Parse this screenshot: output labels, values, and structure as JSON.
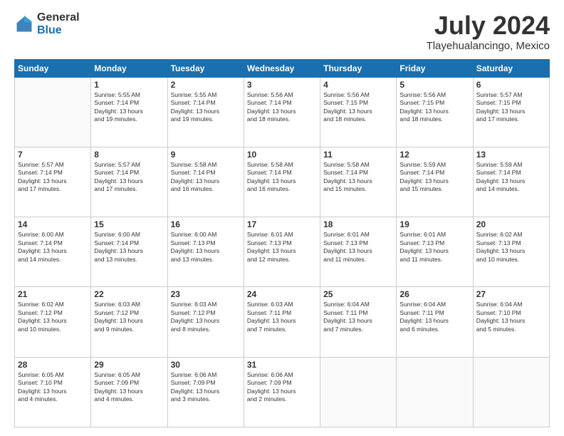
{
  "logo": {
    "general": "General",
    "blue": "Blue"
  },
  "header": {
    "month": "July 2024",
    "location": "Tlayehualancingo, Mexico"
  },
  "weekdays": [
    "Sunday",
    "Monday",
    "Tuesday",
    "Wednesday",
    "Thursday",
    "Friday",
    "Saturday"
  ],
  "weeks": [
    [
      {
        "day": "",
        "info": ""
      },
      {
        "day": "1",
        "info": "Sunrise: 5:55 AM\nSunset: 7:14 PM\nDaylight: 13 hours\nand 19 minutes."
      },
      {
        "day": "2",
        "info": "Sunrise: 5:55 AM\nSunset: 7:14 PM\nDaylight: 13 hours\nand 19 minutes."
      },
      {
        "day": "3",
        "info": "Sunrise: 5:56 AM\nSunset: 7:14 PM\nDaylight: 13 hours\nand 18 minutes."
      },
      {
        "day": "4",
        "info": "Sunrise: 5:56 AM\nSunset: 7:15 PM\nDaylight: 13 hours\nand 18 minutes."
      },
      {
        "day": "5",
        "info": "Sunrise: 5:56 AM\nSunset: 7:15 PM\nDaylight: 13 hours\nand 18 minutes."
      },
      {
        "day": "6",
        "info": "Sunrise: 5:57 AM\nSunset: 7:15 PM\nDaylight: 13 hours\nand 17 minutes."
      }
    ],
    [
      {
        "day": "7",
        "info": "Sunrise: 5:57 AM\nSunset: 7:14 PM\nDaylight: 13 hours\nand 17 minutes."
      },
      {
        "day": "8",
        "info": "Sunrise: 5:57 AM\nSunset: 7:14 PM\nDaylight: 13 hours\nand 17 minutes."
      },
      {
        "day": "9",
        "info": "Sunrise: 5:58 AM\nSunset: 7:14 PM\nDaylight: 13 hours\nand 16 minutes."
      },
      {
        "day": "10",
        "info": "Sunrise: 5:58 AM\nSunset: 7:14 PM\nDaylight: 13 hours\nand 16 minutes."
      },
      {
        "day": "11",
        "info": "Sunrise: 5:58 AM\nSunset: 7:14 PM\nDaylight: 13 hours\nand 15 minutes."
      },
      {
        "day": "12",
        "info": "Sunrise: 5:59 AM\nSunset: 7:14 PM\nDaylight: 13 hours\nand 15 minutes."
      },
      {
        "day": "13",
        "info": "Sunrise: 5:59 AM\nSunset: 7:14 PM\nDaylight: 13 hours\nand 14 minutes."
      }
    ],
    [
      {
        "day": "14",
        "info": "Sunrise: 6:00 AM\nSunset: 7:14 PM\nDaylight: 13 hours\nand 14 minutes."
      },
      {
        "day": "15",
        "info": "Sunrise: 6:00 AM\nSunset: 7:14 PM\nDaylight: 13 hours\nand 13 minutes."
      },
      {
        "day": "16",
        "info": "Sunrise: 6:00 AM\nSunset: 7:13 PM\nDaylight: 13 hours\nand 13 minutes."
      },
      {
        "day": "17",
        "info": "Sunrise: 6:01 AM\nSunset: 7:13 PM\nDaylight: 13 hours\nand 12 minutes."
      },
      {
        "day": "18",
        "info": "Sunrise: 6:01 AM\nSunset: 7:13 PM\nDaylight: 13 hours\nand 11 minutes."
      },
      {
        "day": "19",
        "info": "Sunrise: 6:01 AM\nSunset: 7:13 PM\nDaylight: 13 hours\nand 11 minutes."
      },
      {
        "day": "20",
        "info": "Sunrise: 6:02 AM\nSunset: 7:13 PM\nDaylight: 13 hours\nand 10 minutes."
      }
    ],
    [
      {
        "day": "21",
        "info": "Sunrise: 6:02 AM\nSunset: 7:12 PM\nDaylight: 13 hours\nand 10 minutes."
      },
      {
        "day": "22",
        "info": "Sunrise: 6:03 AM\nSunset: 7:12 PM\nDaylight: 13 hours\nand 9 minutes."
      },
      {
        "day": "23",
        "info": "Sunrise: 6:03 AM\nSunset: 7:12 PM\nDaylight: 13 hours\nand 8 minutes."
      },
      {
        "day": "24",
        "info": "Sunrise: 6:03 AM\nSunset: 7:11 PM\nDaylight: 13 hours\nand 7 minutes."
      },
      {
        "day": "25",
        "info": "Sunrise: 6:04 AM\nSunset: 7:11 PM\nDaylight: 13 hours\nand 7 minutes."
      },
      {
        "day": "26",
        "info": "Sunrise: 6:04 AM\nSunset: 7:11 PM\nDaylight: 13 hours\nand 6 minutes."
      },
      {
        "day": "27",
        "info": "Sunrise: 6:04 AM\nSunset: 7:10 PM\nDaylight: 13 hours\nand 5 minutes."
      }
    ],
    [
      {
        "day": "28",
        "info": "Sunrise: 6:05 AM\nSunset: 7:10 PM\nDaylight: 13 hours\nand 4 minutes."
      },
      {
        "day": "29",
        "info": "Sunrise: 6:05 AM\nSunset: 7:09 PM\nDaylight: 13 hours\nand 4 minutes."
      },
      {
        "day": "30",
        "info": "Sunrise: 6:06 AM\nSunset: 7:09 PM\nDaylight: 13 hours\nand 3 minutes."
      },
      {
        "day": "31",
        "info": "Sunrise: 6:06 AM\nSunset: 7:09 PM\nDaylight: 13 hours\nand 2 minutes."
      },
      {
        "day": "",
        "info": ""
      },
      {
        "day": "",
        "info": ""
      },
      {
        "day": "",
        "info": ""
      }
    ]
  ]
}
